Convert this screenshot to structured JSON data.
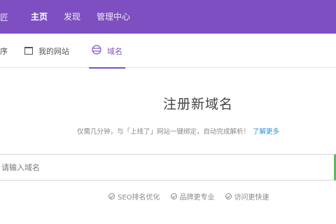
{
  "topbar": {
    "brand": "匠",
    "nav": [
      {
        "label": "主页",
        "active": true
      },
      {
        "label": "发现",
        "active": false
      },
      {
        "label": "管理中心",
        "active": false
      }
    ]
  },
  "subnav": {
    "tabs": [
      {
        "label": "序",
        "icon": "none"
      },
      {
        "label": "我的网站",
        "icon": "box-icon"
      },
      {
        "label": "域名",
        "icon": "globe-icon",
        "active": true
      }
    ]
  },
  "main": {
    "heading": "注册新域名",
    "subline": "仅需几分钟，与「上线了」网站一键绑定，自动完成解析！",
    "learn_more": "了解更多",
    "search_placeholder": "请输入域名",
    "features": [
      "SEO排名优化",
      "品牌更专业",
      "访问更快速"
    ]
  },
  "colors": {
    "brand_purple": "#7d4fc0",
    "link_blue": "#2d8fd6",
    "accent_green": "#5cb85c"
  }
}
